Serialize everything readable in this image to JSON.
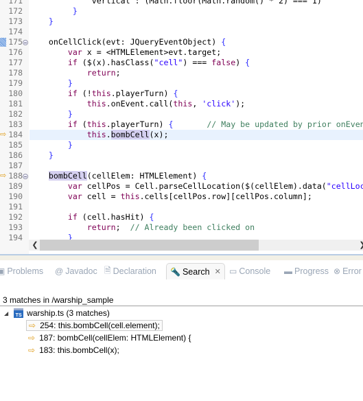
{
  "editor": {
    "lines": [
      {
        "n": "171",
        "tokens": [
          [
            "             ",
            ""
          ],
          [
            "vertical",
            ""
          ],
          [
            " : (Math.floor(Math.random() * 2) === 1)",
            ""
          ]
        ]
      },
      {
        "n": "172",
        "tokens": [
          [
            "         ",
            ""
          ],
          [
            "}",
            "br"
          ]
        ]
      },
      {
        "n": "173",
        "tokens": [
          [
            "    ",
            ""
          ],
          [
            "}",
            "br"
          ]
        ]
      },
      {
        "n": "174",
        "tokens": []
      },
      {
        "n": "175",
        "fold": true,
        "breakpoint": true,
        "tokens": [
          [
            "    onCellClick(evt: JQueryEventObject) ",
            ""
          ],
          [
            "{",
            "br"
          ]
        ]
      },
      {
        "n": "176",
        "tokens": [
          [
            "        ",
            ""
          ],
          [
            "var",
            "kw"
          ],
          [
            " x = <HTMLElement>evt.target;",
            ""
          ]
        ]
      },
      {
        "n": "177",
        "tokens": [
          [
            "        ",
            ""
          ],
          [
            "if",
            "kw"
          ],
          [
            " ($(x).hasClass(",
            ""
          ],
          [
            "\"cell\"",
            "str"
          ],
          [
            ") === ",
            ""
          ],
          [
            "false",
            "kw"
          ],
          [
            ") ",
            ""
          ],
          [
            "{",
            "br"
          ]
        ]
      },
      {
        "n": "178",
        "tokens": [
          [
            "            ",
            ""
          ],
          [
            "return",
            "kw"
          ],
          [
            ";",
            ""
          ]
        ]
      },
      {
        "n": "179",
        "tokens": [
          [
            "        ",
            ""
          ],
          [
            "}",
            "br"
          ]
        ]
      },
      {
        "n": "180",
        "tokens": [
          [
            "        ",
            ""
          ],
          [
            "if",
            "kw"
          ],
          [
            " (!",
            ""
          ],
          [
            "this",
            "kw"
          ],
          [
            ".playerTurn) ",
            ""
          ],
          [
            "{",
            "br"
          ]
        ]
      },
      {
        "n": "181",
        "tokens": [
          [
            "            ",
            ""
          ],
          [
            "this",
            "kw"
          ],
          [
            ".onEvent.call(",
            ""
          ],
          [
            "this",
            "kw"
          ],
          [
            ", ",
            ""
          ],
          [
            "'click'",
            "str"
          ],
          [
            ");",
            ""
          ]
        ]
      },
      {
        "n": "182",
        "tokens": [
          [
            "        ",
            ""
          ],
          [
            "}",
            "br"
          ]
        ]
      },
      {
        "n": "183",
        "tokens": [
          [
            "        ",
            ""
          ],
          [
            "if",
            "kw"
          ],
          [
            " (",
            ""
          ],
          [
            "this",
            "kw"
          ],
          [
            ".playerTurn) ",
            ""
          ],
          [
            "{",
            "br"
          ],
          [
            "       ",
            ""
          ],
          [
            "// May be updated by prior onEvent",
            "cm"
          ]
        ]
      },
      {
        "n": "184",
        "current": true,
        "marker": true,
        "tokens": [
          [
            "            ",
            ""
          ],
          [
            "this",
            "kw"
          ],
          [
            ".",
            ""
          ],
          [
            "bombCell",
            "hl"
          ],
          [
            "(x);",
            ""
          ]
        ]
      },
      {
        "n": "185",
        "tokens": [
          [
            "        ",
            ""
          ],
          [
            "}",
            "br"
          ]
        ]
      },
      {
        "n": "186",
        "tokens": [
          [
            "    ",
            ""
          ],
          [
            "}",
            "br"
          ]
        ]
      },
      {
        "n": "187",
        "tokens": []
      },
      {
        "n": "188",
        "fold": true,
        "marker": true,
        "tokens": [
          [
            "    ",
            ""
          ],
          [
            "bombCell",
            "hl"
          ],
          [
            "(cellElem: HTMLElement) ",
            ""
          ],
          [
            "{",
            "br"
          ]
        ]
      },
      {
        "n": "189",
        "tokens": [
          [
            "        ",
            ""
          ],
          [
            "var",
            "kw"
          ],
          [
            " cellPos = Cell.parseCellLocation($(cellElem).data(",
            ""
          ],
          [
            "\"cellLocation\"",
            "str"
          ]
        ]
      },
      {
        "n": "190",
        "tokens": [
          [
            "        ",
            ""
          ],
          [
            "var",
            "kw"
          ],
          [
            " cell = ",
            ""
          ],
          [
            "this",
            "kw"
          ],
          [
            ".cells[cellPos.row][cellPos.column];",
            ""
          ]
        ]
      },
      {
        "n": "191",
        "tokens": []
      },
      {
        "n": "192",
        "tokens": [
          [
            "        ",
            ""
          ],
          [
            "if",
            "kw"
          ],
          [
            " (cell.hasHit) ",
            ""
          ],
          [
            "{",
            "br"
          ]
        ]
      },
      {
        "n": "193",
        "tokens": [
          [
            "            ",
            ""
          ],
          [
            "return",
            "kw"
          ],
          [
            ";  ",
            ""
          ],
          [
            "// Already been clicked on",
            "cm"
          ]
        ]
      },
      {
        "n": "194",
        "tokens": [
          [
            "        ",
            ""
          ],
          [
            "}",
            "br"
          ]
        ]
      }
    ]
  },
  "panel": {
    "tabs": [
      {
        "label": "Problems",
        "icon": "problems-icon"
      },
      {
        "label": "Javadoc",
        "icon": "at-icon"
      },
      {
        "label": "Declaration",
        "icon": "declaration-icon"
      },
      {
        "label": "Search",
        "icon": "search-flashlight-icon",
        "active": true
      },
      {
        "label": "Console",
        "icon": "console-icon"
      },
      {
        "label": "Progress",
        "icon": "progress-icon"
      },
      {
        "label": "Error Log",
        "icon": "error-log-icon"
      }
    ],
    "summary": "3 matches in /warship_sample",
    "file": {
      "label": "warship.ts (3 matches)",
      "icon_text": "TS"
    },
    "matches": [
      "254: this.bombCell(cell.element);",
      "187: bombCell(cellElem: HTMLElement) {",
      "183: this.bombCell(x);"
    ]
  },
  "colors": {
    "keyword": "#7f0055",
    "string": "#2a00ff",
    "comment": "#3f7f5f",
    "current_line": "#e8f2fe",
    "occurrence": "#d4cff0"
  }
}
